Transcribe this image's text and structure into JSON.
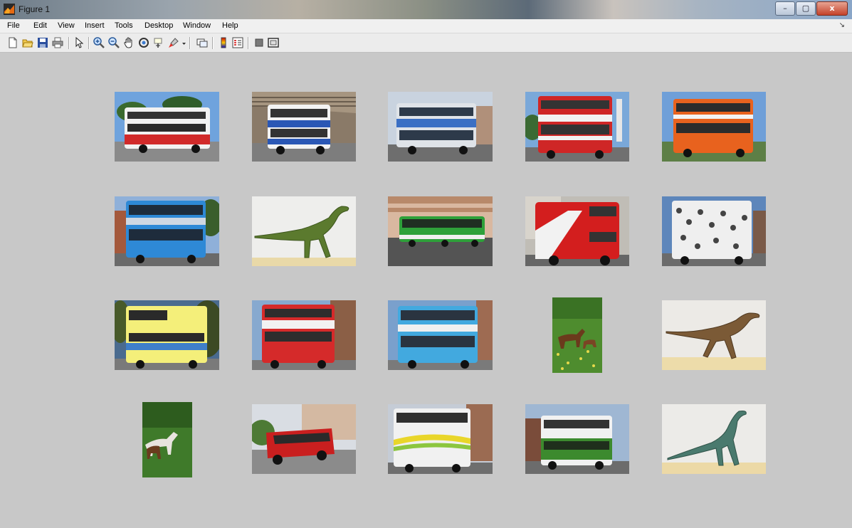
{
  "window": {
    "title": "Figure 1",
    "minimize_glyph": "–",
    "maximize_glyph": "▢",
    "close_glyph": "x"
  },
  "menu": {
    "items": [
      "File",
      "Edit",
      "View",
      "Insert",
      "Tools",
      "Desktop",
      "Window",
      "Help"
    ],
    "dock_arrow": "↘"
  },
  "toolbar": {
    "icons": [
      "new-figure-icon",
      "open-file-icon",
      "save-icon",
      "print-icon",
      "edit-plot-arrow-icon",
      "zoom-in-icon",
      "zoom-out-icon",
      "pan-hand-icon",
      "rotate-3d-icon",
      "data-cursor-icon",
      "brush-icon",
      "brush-dropdown-icon",
      "link-plot-icon",
      "insert-colorbar-icon",
      "insert-legend-icon",
      "hide-plot-tools-icon",
      "show-plot-tools-icon"
    ]
  },
  "grid": {
    "rows": [
      [
        "red-white-double-decker-bus",
        "blue-white-double-decker-bus",
        "blue-silver-double-decker-bus",
        "red-white-cardiff-bus",
        "orange-double-decker-bus"
      ],
      [
        "blue-double-decker-bus",
        "green-dinosaur",
        "green-articulated-bus",
        "red-routemaster-bus",
        "white-bus-with-print-livery"
      ],
      [
        "yellow-whippet-bus",
        "red-white-double-decker-bus-2",
        "blue-white-double-decker-bus-2",
        "horses-in-green-field",
        "brown-dinosaur"
      ],
      [
        "horses-in-meadow",
        "red-vintage-single-decker-bus",
        "white-yellow-double-decker-bus",
        "green-white-double-decker-bus",
        "long-neck-dinosaur"
      ]
    ]
  },
  "colors": {
    "canvas": "#c8c8c8",
    "menubar": "#f0f0f0",
    "toolbar": "#ececec"
  }
}
